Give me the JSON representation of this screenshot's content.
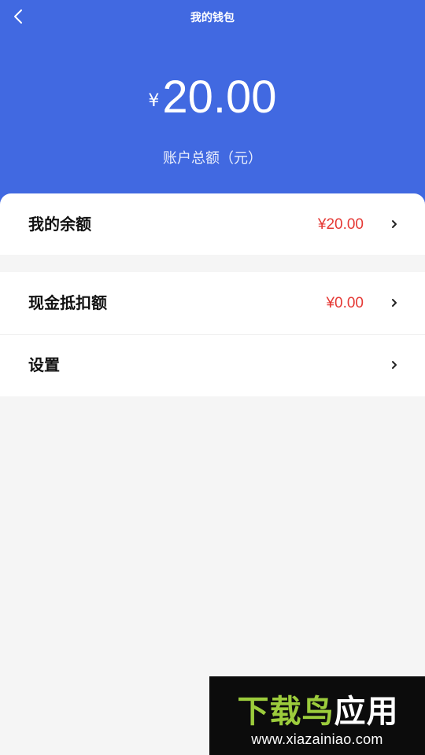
{
  "header": {
    "title": "我的钱包",
    "currency_symbol": "¥",
    "total_amount": "20.00",
    "total_label": "账户总额（元）"
  },
  "rows": [
    {
      "label": "我的余额",
      "value": "¥20.00"
    },
    {
      "label": "现金抵扣额",
      "value": "¥0.00"
    },
    {
      "label": "设置",
      "value": ""
    }
  ],
  "watermark": {
    "title": "下载鸟应用",
    "url": "www.xiazainiao.com"
  },
  "colors": {
    "header_bg": "#4169e1",
    "value_red": "#e53935",
    "page_bg": "#f5f5f5",
    "watermark_green": "#9ccc3c"
  },
  "icons": [
    "back-chevron-icon",
    "chevron-right-icon"
  ]
}
